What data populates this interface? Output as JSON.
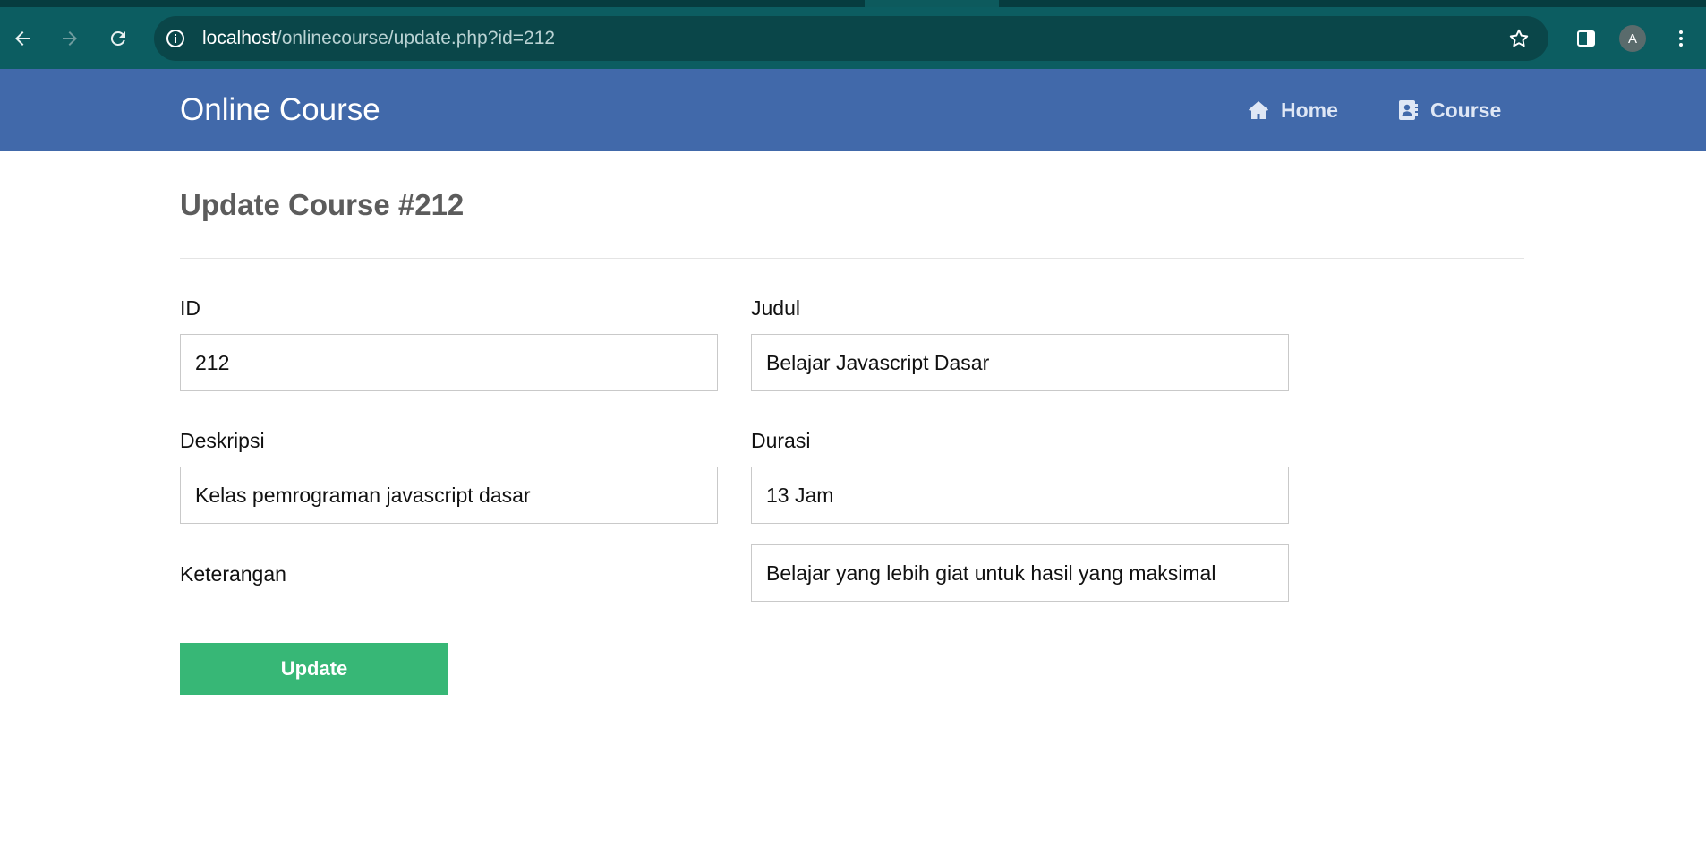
{
  "browser": {
    "url_host": "localhost",
    "url_path": "/onlinecourse/update.php?id=212",
    "profile_initial": "A",
    "icons": [
      "back-icon",
      "forward-icon",
      "reload-icon",
      "site-info-icon",
      "bookmark-star-icon",
      "side-panel-icon",
      "menu-dots-icon"
    ]
  },
  "navbar": {
    "brand": "Online Course",
    "links": [
      {
        "label": "Home",
        "icon": "home-icon"
      },
      {
        "label": "Course",
        "icon": "address-book-icon"
      }
    ],
    "background": "#4169aa"
  },
  "page": {
    "title": "Update Course #212"
  },
  "form": {
    "id": {
      "label": "ID",
      "value": "212"
    },
    "judul": {
      "label": "Judul",
      "value": "Belajar Javascript Dasar"
    },
    "deskripsi": {
      "label": "Deskripsi",
      "value": "Kelas pemrograman javascript dasar"
    },
    "durasi": {
      "label": "Durasi",
      "value": "13 Jam"
    },
    "keterangan": {
      "label": "Keterangan",
      "value": "Belajar yang lebih giat untuk hasil yang maksimal"
    },
    "submit_label": "Update",
    "submit_color": "#37b776"
  }
}
